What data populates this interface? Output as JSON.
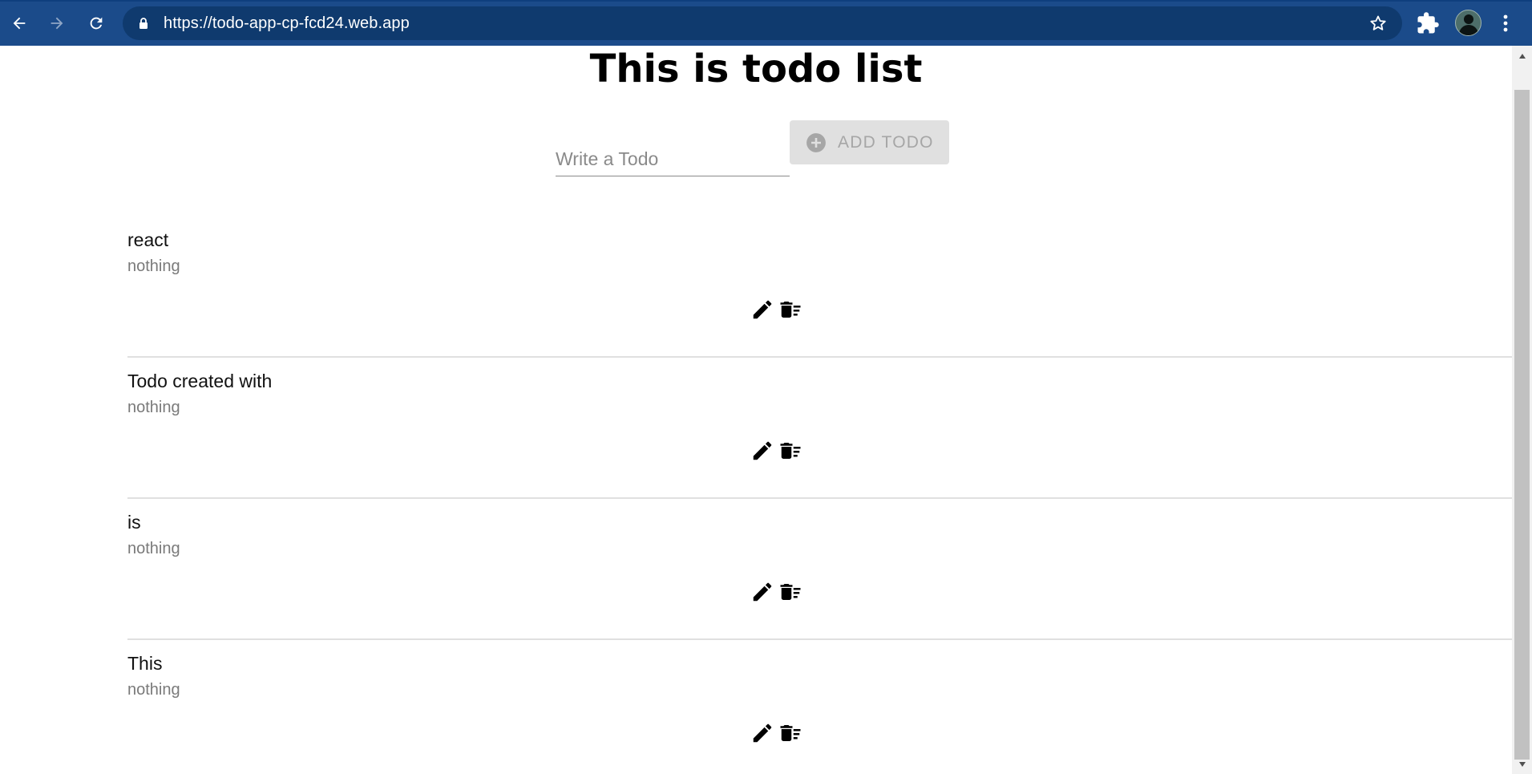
{
  "browser": {
    "url": "https://todo-app-cp-fcd24.web.app",
    "icons": {
      "back": "back-arrow-icon",
      "forward": "forward-arrow-icon",
      "reload": "reload-icon",
      "lock": "lock-icon",
      "bookmark": "star-icon",
      "extensions": "puzzle-icon",
      "profile": "avatar",
      "menu": "kebab-menu-icon"
    },
    "colors": {
      "toolbar": "#1b4b8a",
      "omnibox": "#0f3a6e"
    }
  },
  "page": {
    "title": "This is todo list",
    "input": {
      "placeholder": "Write a Todo",
      "value": ""
    },
    "add_button": {
      "label": "ADD TODO",
      "icon": "add-circle-icon",
      "disabled": true
    }
  },
  "todos": [
    {
      "title": "react",
      "description": "nothing"
    },
    {
      "title": "Todo created with",
      "description": "nothing"
    },
    {
      "title": "is",
      "description": "nothing"
    },
    {
      "title": "This",
      "description": "nothing"
    }
  ],
  "todo_actions": {
    "edit_icon": "pencil-icon",
    "delete_icon": "delete-sweep-icon"
  }
}
